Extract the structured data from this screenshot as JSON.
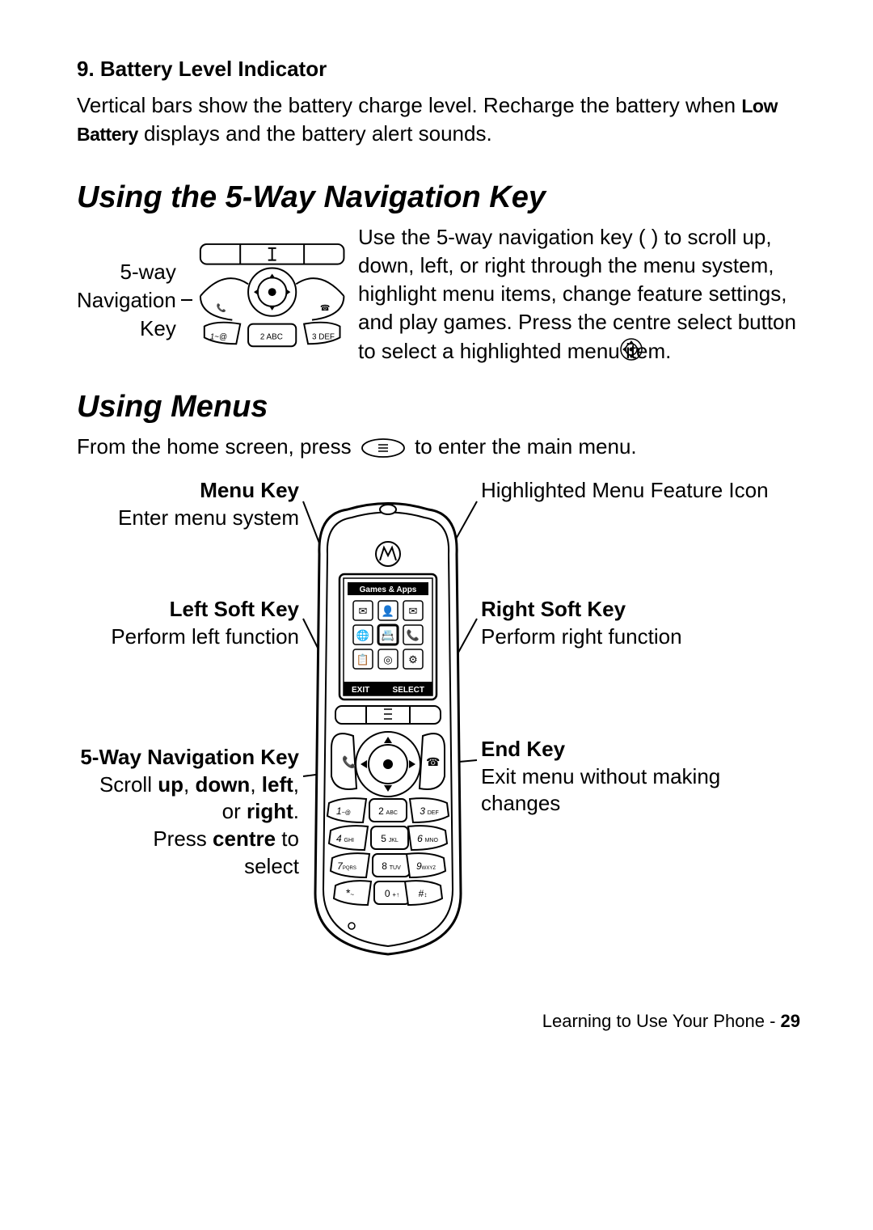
{
  "section9": {
    "heading": "9. Battery Level Indicator",
    "body_pre": "Vertical bars show the battery charge level. Recharge the battery when ",
    "low_battery": "Low Battery",
    "body_post": " displays and the battery alert sounds."
  },
  "nav": {
    "heading": "Using the 5-Way Navigation Key",
    "label_line1": "5-way",
    "label_line2": "Navigation",
    "label_line3": "Key",
    "para": "Use the 5-way navigation key (      ) to scroll up, down, left, or right through the menu system, highlight menu items, change feature settings, and play games. Press the centre select button to select a highlighted menu item."
  },
  "menus": {
    "heading": "Using Menus",
    "intro_pre": "From the home screen, press ",
    "intro_post": " to enter the main menu."
  },
  "callouts": {
    "menu_key_title": "Menu Key",
    "menu_key_sub": "Enter menu system",
    "left_soft_title": "Left Soft Key",
    "left_soft_sub": "Perform left function",
    "fiveway_title": "5-Way Navigation Key",
    "fiveway_l1a": "Scroll ",
    "fiveway_l1b": "up",
    "fiveway_l1c": ", ",
    "fiveway_l1d": "down",
    "fiveway_l1e": ", ",
    "fiveway_l1f": "left",
    "fiveway_l1g": ",",
    "fiveway_l2a": "or ",
    "fiveway_l2b": "right",
    "fiveway_l2c": ".",
    "fiveway_l3a": "Press ",
    "fiveway_l3b": "centre",
    "fiveway_l3c": " to",
    "fiveway_l4": "select",
    "highlighted_title": "Highlighted Menu Feature Icon",
    "right_soft_title": "Right Soft Key",
    "right_soft_sub": "Perform right function",
    "end_key_title": "End Key",
    "end_key_sub": "Exit menu without making changes"
  },
  "phone_screen": {
    "title": "Games & Apps",
    "exit": "EXIT",
    "select": "SELECT"
  },
  "keypad": {
    "k1": "1",
    "k1s": "~@",
    "k2": "2",
    "k2s": "ABC",
    "k3": "3",
    "k3s": "DEF",
    "k4": "4",
    "k4s": "GHI",
    "k5": "5",
    "k5s": "JKL",
    "k6": "6",
    "k6s": "MNO",
    "k7": "7",
    "k7s": "PQRS",
    "k8": "8",
    "k8s": "TUV",
    "k9": "9",
    "k9s": "WXYZ",
    "kstar": "*",
    "kstars": "~",
    "k0": "0",
    "k0s": "+↑",
    "khash": "#",
    "khashs": "↕"
  },
  "footer": {
    "text": "Learning to Use Your Phone - ",
    "page": "29"
  }
}
